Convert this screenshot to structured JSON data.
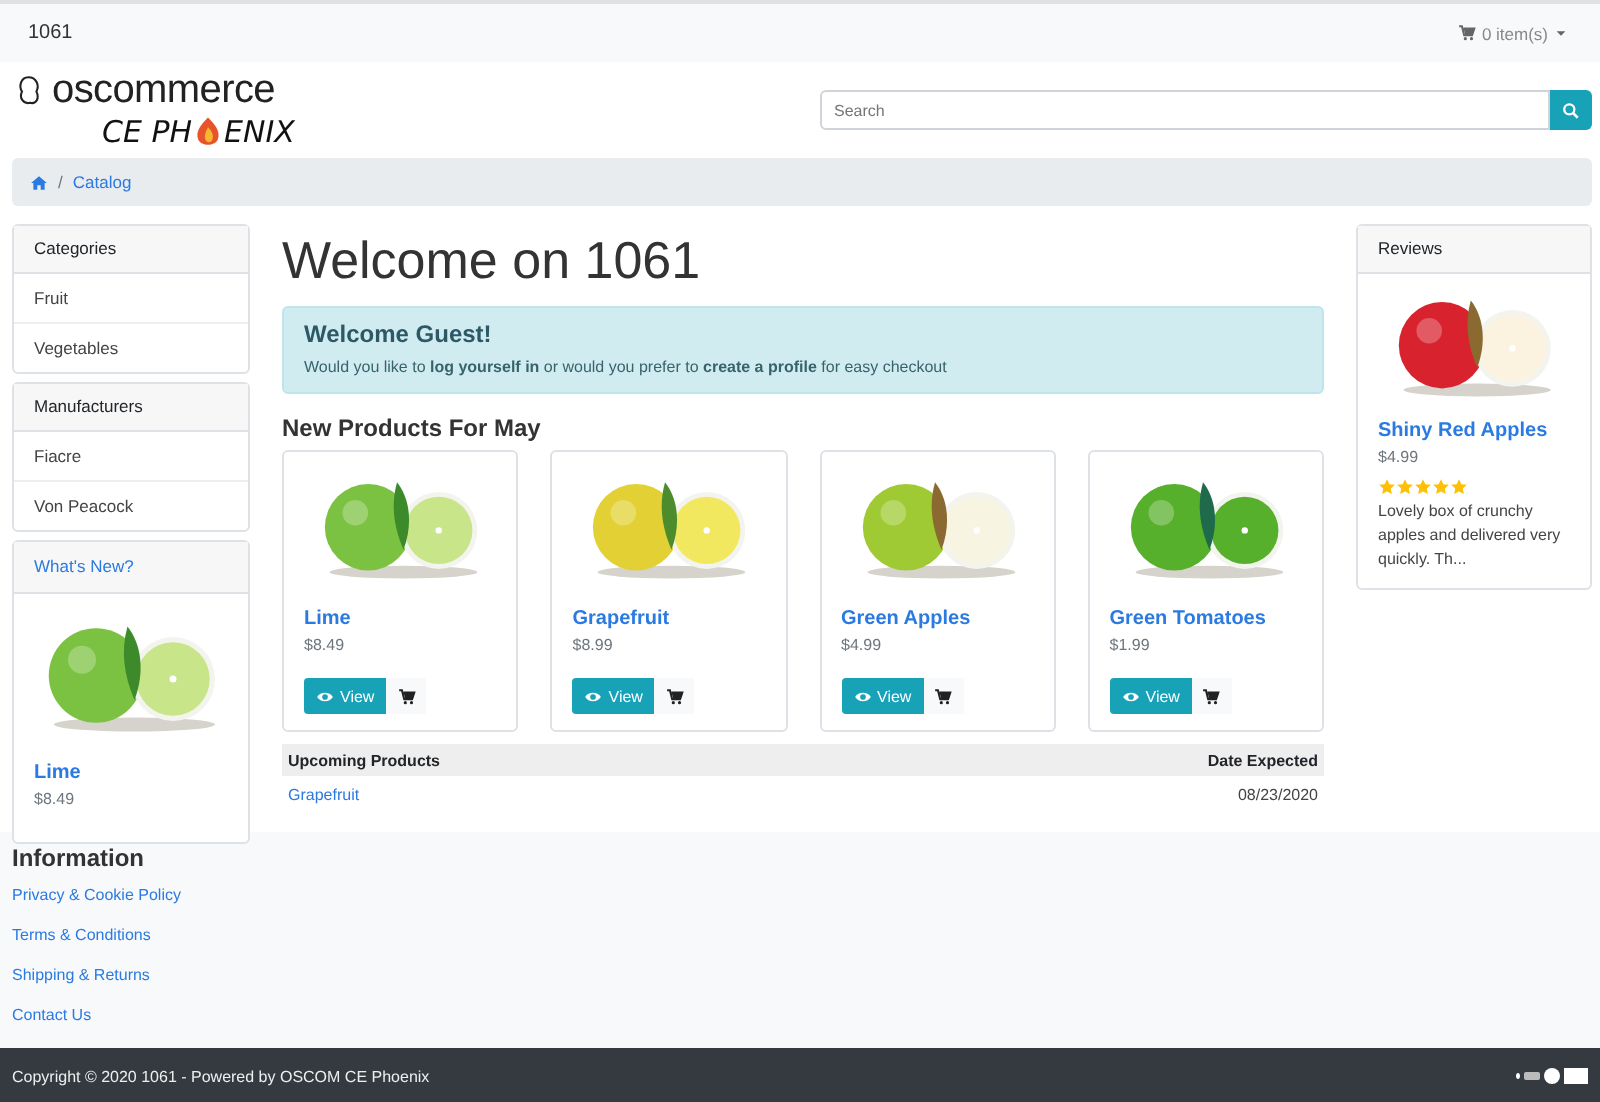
{
  "top_bar": {
    "store_name": "1061",
    "cart": "0 item(s)"
  },
  "logo": {
    "wordmark": "oscommerce",
    "tagline_parts": [
      "CE PH",
      "ENIX"
    ]
  },
  "search": {
    "placeholder": "Search"
  },
  "breadcrumb": {
    "separator": "/",
    "items": [
      {
        "label": "Catalog"
      }
    ]
  },
  "left_column": [
    {
      "kind": "list",
      "title": "Categories",
      "items": [
        "Fruit",
        "Vegetables"
      ]
    },
    {
      "kind": "list",
      "title": "Manufacturers",
      "items": [
        "Fiacre",
        "Von Peacock"
      ]
    },
    {
      "kind": "product",
      "title": "What's New?",
      "name": "Lime",
      "price": "$8.49"
    }
  ],
  "title": "Welcome on 1061",
  "alert": {
    "heading": "Welcome Guest!",
    "text": "Would you like to **log yourself in** or would you prefer to **create a profile** for easy checkout"
  },
  "new_products": {
    "heading": "New Products For May",
    "items": [
      {
        "name": "Lime",
        "price": "$8.49",
        "button": "View"
      },
      {
        "name": "Grapefruit",
        "price": "$8.99",
        "button": "View"
      },
      {
        "name": "Green Apples",
        "price": "$4.99",
        "button": "View"
      },
      {
        "name": "Green Tomatoes",
        "price": "$1.99",
        "button": "View"
      }
    ]
  },
  "upcoming": {
    "columns": [
      "Upcoming Products",
      "Date Expected"
    ],
    "rows": [
      [
        "Grapefruit",
        "08/23/2020"
      ]
    ]
  },
  "reviews": {
    "title": "Reviews",
    "name": "Shiny Red Apples",
    "price": "$4.99",
    "stars": 5,
    "text": "Lovely box of crunchy apples and delivered very quickly. Th..."
  },
  "footer": {
    "heading": "Information",
    "links": [
      "Privacy & Cookie Policy",
      "Terms & Conditions",
      "Shipping & Returns",
      "Contact Us"
    ]
  },
  "copyright": "Copyright © 2020 1061 - Powered by OSCOM CE Phoenix"
}
